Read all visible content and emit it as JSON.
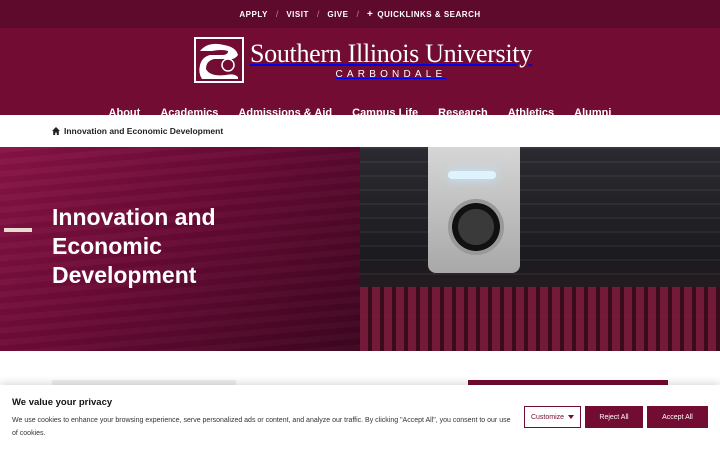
{
  "utility_nav": {
    "apply": "APPLY",
    "visit": "VISIT",
    "give": "GIVE",
    "quicklinks": "QUICKLINKS & SEARCH",
    "separator": "/"
  },
  "brand": {
    "name": "Southern Illinois University",
    "campus": "CARBONDALE",
    "color": "#720c33"
  },
  "main_nav": {
    "items": [
      "About",
      "Academics",
      "Admissions & Aid",
      "Campus Life",
      "Research",
      "Athletics",
      "Alumni"
    ]
  },
  "breadcrumb": {
    "current": "Innovation and Economic Development"
  },
  "hero": {
    "title": "Innovation and Economic Development"
  },
  "cookie_banner": {
    "title": "We value your privacy",
    "body": "We use cookies to enhance your browsing experience, serve personalized ads or content, and analyze our traffic. By clicking \"Accept All\", you consent to our use of cookies.",
    "customize": "Customize",
    "reject": "Reject All",
    "accept": "Accept All"
  }
}
